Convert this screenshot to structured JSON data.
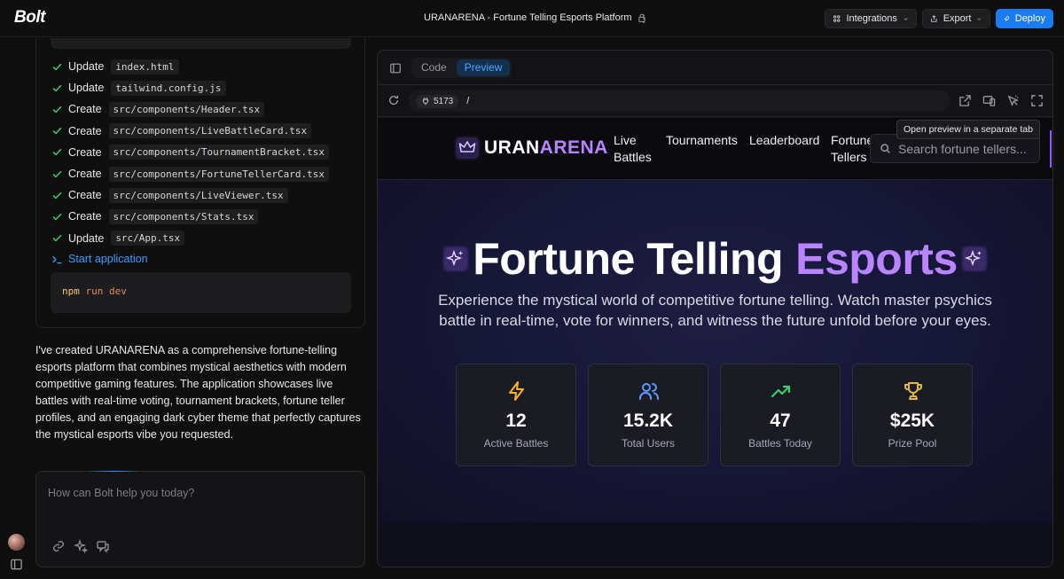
{
  "app": {
    "logo": "Bolt",
    "project_title": "URANARENA - Fortune Telling Esports Platform"
  },
  "toolbar": {
    "integrations_label": "Integrations",
    "export_label": "Export",
    "deploy_label": "Deploy"
  },
  "steps": [
    {
      "action": "Update",
      "file": "index.html"
    },
    {
      "action": "Update",
      "file": "tailwind.config.js"
    },
    {
      "action": "Create",
      "file": "src/components/Header.tsx"
    },
    {
      "action": "Create",
      "file": "src/components/LiveBattleCard.tsx"
    },
    {
      "action": "Create",
      "file": "src/components/TournamentBracket.tsx"
    },
    {
      "action": "Create",
      "file": "src/components/FortuneTellerCard.tsx"
    },
    {
      "action": "Create",
      "file": "src/components/LiveViewer.tsx"
    },
    {
      "action": "Create",
      "file": "src/components/Stats.tsx"
    },
    {
      "action": "Update",
      "file": "src/App.tsx"
    }
  ],
  "start_label": "Start application",
  "command": {
    "npm": "npm",
    "rest": "run dev"
  },
  "message": "I've created URANARENA as a comprehensive fortune-telling esports platform that combines mystical aesthetics with modern competitive gaming features. The application showcases live battles with real-time voting, tournament brackets, fortune teller profiles, and an engaging dark cyber theme that perfectly captures the mystical esports vibe you requested.",
  "prompt": {
    "placeholder": "How can Bolt help you today?"
  },
  "workbench": {
    "tab_code": "Code",
    "tab_preview": "Preview",
    "port": "5173",
    "path": "/",
    "tooltip": "Open preview in a separate tab"
  },
  "preview": {
    "logo_part1": "URAN",
    "logo_part2": "ARENA",
    "nav": [
      {
        "line1": "Live",
        "line2": "Battles"
      },
      {
        "line1": "Tournaments",
        "line2": ""
      },
      {
        "line1": "Leaderboard",
        "line2": ""
      },
      {
        "line1": "Fortune",
        "line2": "Tellers"
      }
    ],
    "search_placeholder": "Search fortune tellers...",
    "hero_title_1": "Fortune Telling",
    "hero_title_2": "Esports",
    "hero_subtitle": "Experience the mystical world of competitive fortune telling. Watch master psychics battle in real-time, vote for winners, and witness the future unfold before your eyes.",
    "stats": [
      {
        "value": "12",
        "label": "Active Battles",
        "icon": "bolt-icon",
        "color": "#f5b325"
      },
      {
        "value": "15.2K",
        "label": "Total Users",
        "icon": "users-icon",
        "color": "#5b9cff"
      },
      {
        "value": "47",
        "label": "Battles Today",
        "icon": "trending-up-icon",
        "color": "#3ecf6e"
      },
      {
        "value": "$25K",
        "label": "Prize Pool",
        "icon": "trophy-icon",
        "color": "#e0b84a"
      }
    ]
  },
  "colors": {
    "accent": "#1b7cf2",
    "brand_purple": "#b884ff",
    "check_green": "#3ecf6e"
  }
}
